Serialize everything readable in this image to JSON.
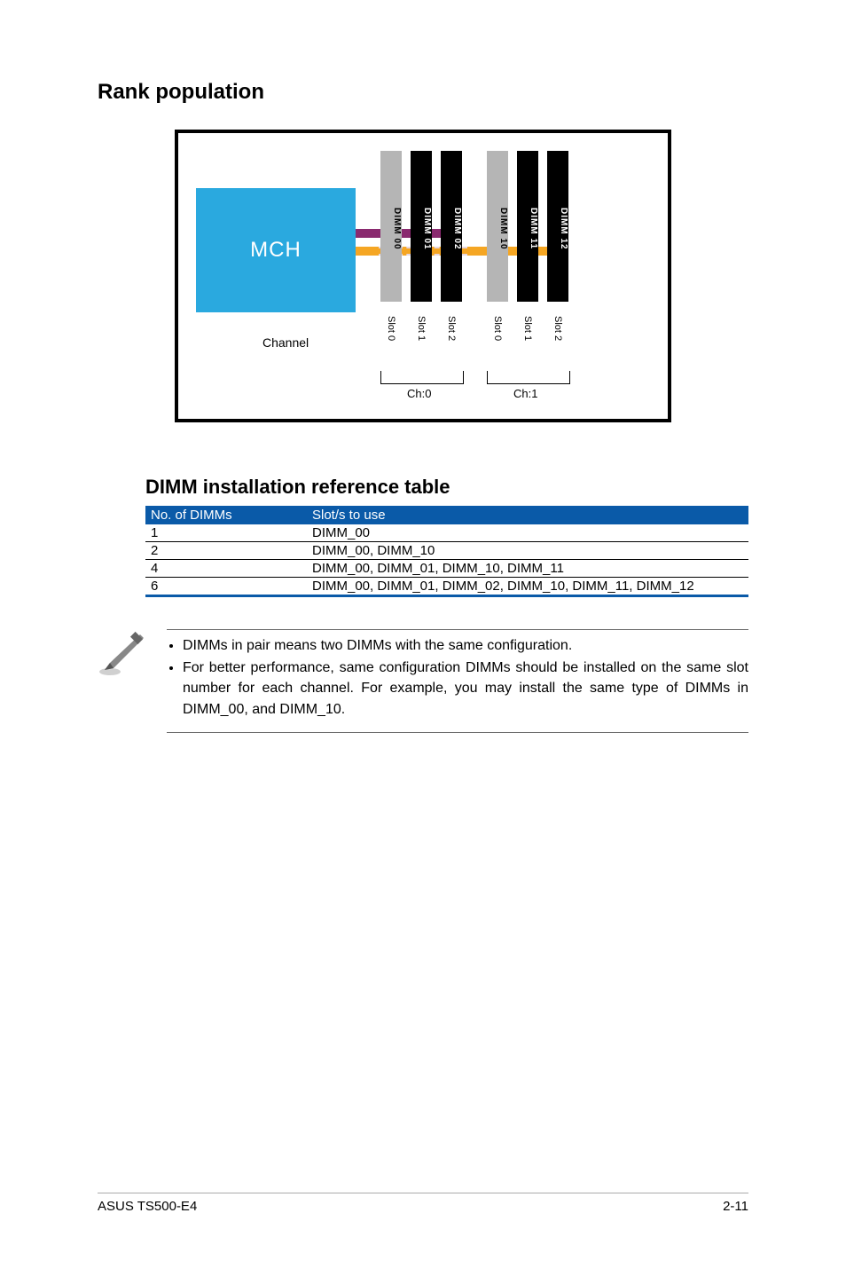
{
  "headings": {
    "rank_population": "Rank population",
    "dimm_ref_table": "DIMM installation reference table"
  },
  "diagram": {
    "mch": "MCH",
    "channel_label": "Channel",
    "groups": [
      {
        "ch_label": "Ch:0",
        "slots": [
          {
            "name": "DIMM 00",
            "slot": "Slot 0",
            "color": "grey"
          },
          {
            "name": "DIMM 01",
            "slot": "Slot 1",
            "color": "black"
          },
          {
            "name": "DIMM 02",
            "slot": "Slot 2",
            "color": "black"
          }
        ]
      },
      {
        "ch_label": "Ch:1",
        "slots": [
          {
            "name": "DIMM 10",
            "slot": "Slot 0",
            "color": "grey"
          },
          {
            "name": "DIMM 11",
            "slot": "Slot 1",
            "color": "black"
          },
          {
            "name": "DIMM 12",
            "slot": "Slot 2",
            "color": "black"
          }
        ]
      }
    ]
  },
  "table": {
    "headers": {
      "col1": "No. of DIMMs",
      "col2": "Slot/s to use"
    },
    "rows": [
      {
        "n": "1",
        "slots": "DIMM_00"
      },
      {
        "n": "2",
        "slots": "DIMM_00, DIMM_10"
      },
      {
        "n": "4",
        "slots": "DIMM_00, DIMM_01, DIMM_10, DIMM_11"
      },
      {
        "n": "6",
        "slots": "DIMM_00, DIMM_01, DIMM_02, DIMM_10, DIMM_11, DIMM_12"
      }
    ]
  },
  "notes": {
    "b1": "DIMMs in pair means two DIMMs with the same configuration.",
    "b2": "For better performance, same configuration DIMMs should be installed on the same slot number for each channel. For example, you may install the same type of DIMMs in DIMM_00, and DIMM_10."
  },
  "footer": {
    "left": "ASUS TS500-E4",
    "right": "2-11"
  }
}
